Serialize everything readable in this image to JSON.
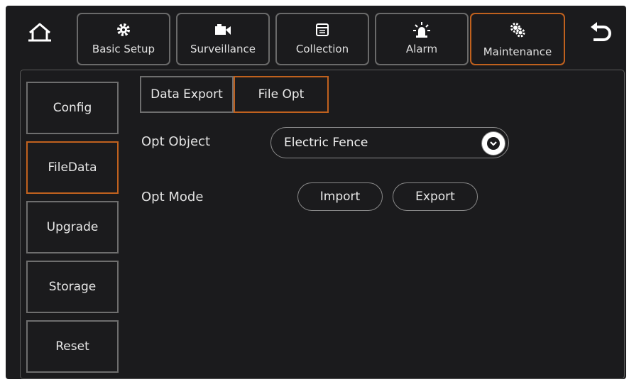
{
  "nav": {
    "tabs": [
      {
        "label": "Basic Setup",
        "icon": "gear-icon"
      },
      {
        "label": "Surveillance",
        "icon": "camera-icon"
      },
      {
        "label": "Collection",
        "icon": "collection-icon"
      },
      {
        "label": "Alarm",
        "icon": "alarm-icon"
      },
      {
        "label": "Maintenance",
        "icon": "maintenance-icon",
        "active": true
      }
    ]
  },
  "sidebar": {
    "items": [
      {
        "label": "Config"
      },
      {
        "label": "FileData",
        "active": true
      },
      {
        "label": "Upgrade"
      },
      {
        "label": "Storage"
      },
      {
        "label": "Reset"
      }
    ]
  },
  "subtabs": [
    {
      "label": "Data Export"
    },
    {
      "label": "File Opt",
      "active": true
    }
  ],
  "form": {
    "opt_object_label": "Opt Object",
    "opt_object_value": "Electric Fence",
    "opt_mode_label": "Opt Mode",
    "import_label": "Import",
    "export_label": "Export"
  },
  "colors": {
    "accent": "#c0611e",
    "background": "#1b1b1d",
    "border": "#6e6e6e"
  }
}
